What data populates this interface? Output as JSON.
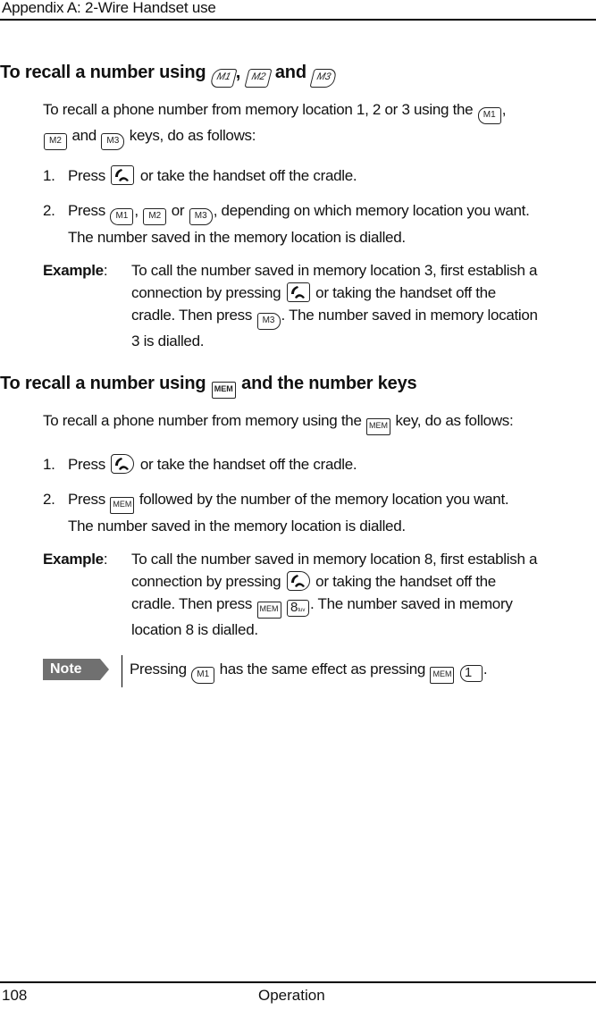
{
  "header": {
    "title": "Appendix A:  2-Wire Handset use"
  },
  "footer": {
    "page_number": "108",
    "section": "Operation"
  },
  "keys": {
    "m1": "M1",
    "m2": "M2",
    "m3": "M3",
    "mem": "MEM",
    "eight": "8",
    "eight_letters": "tuv",
    "one": "1"
  },
  "section1": {
    "heading_prefix": "To recall a number using",
    "heading_sep": ",",
    "heading_and": "and",
    "intro": {
      "part1": "To recall a phone number from memory location 1, 2 or 3 using the",
      "comma": ",",
      "and": "and",
      "part2": "keys, do as follows:"
    },
    "steps": [
      {
        "num": "1.",
        "press": "Press",
        "rest": "or take the handset off the cradle."
      },
      {
        "num": "2.",
        "press": "Press",
        "comma": ",",
        "or": "or",
        "rest": ", depending on which memory location you want."
      }
    ],
    "step_result": "The number saved in the memory location is dialled.",
    "example": {
      "label": "Example",
      "colon": ":",
      "line1": "To call the number saved in memory location 3, first establish a",
      "line2a": "connection by pressing",
      "line2b": "or taking the handset off the",
      "line3a": "cradle. Then press",
      "line3b": ". The number saved in memory location",
      "line4": "3 is dialled."
    }
  },
  "section2": {
    "heading_prefix": "To recall a number using",
    "heading_suffix": "and the number keys",
    "intro": {
      "part1": "To recall a phone number from memory using the",
      "part2": "key, do as follows:"
    },
    "steps": [
      {
        "num": "1.",
        "press": "Press",
        "rest": "or take the handset off the cradle."
      },
      {
        "num": "2.",
        "press": "Press",
        "rest": "followed by the number of the memory location you want."
      }
    ],
    "step_result": "The number saved in the memory location is dialled.",
    "example": {
      "label": "Example",
      "colon": ":",
      "line1": "To call the number saved in memory location 8, first establish a",
      "line2a": "connection by pressing",
      "line2b": "or taking the handset off the",
      "line3a": "cradle. Then press",
      "line3b": ". The number saved in memory",
      "line4": "location 8 is dialled."
    },
    "note": {
      "badge": "Note",
      "text_a": "Pressing",
      "text_b": "has the same effect as pressing",
      "text_c": "."
    }
  }
}
